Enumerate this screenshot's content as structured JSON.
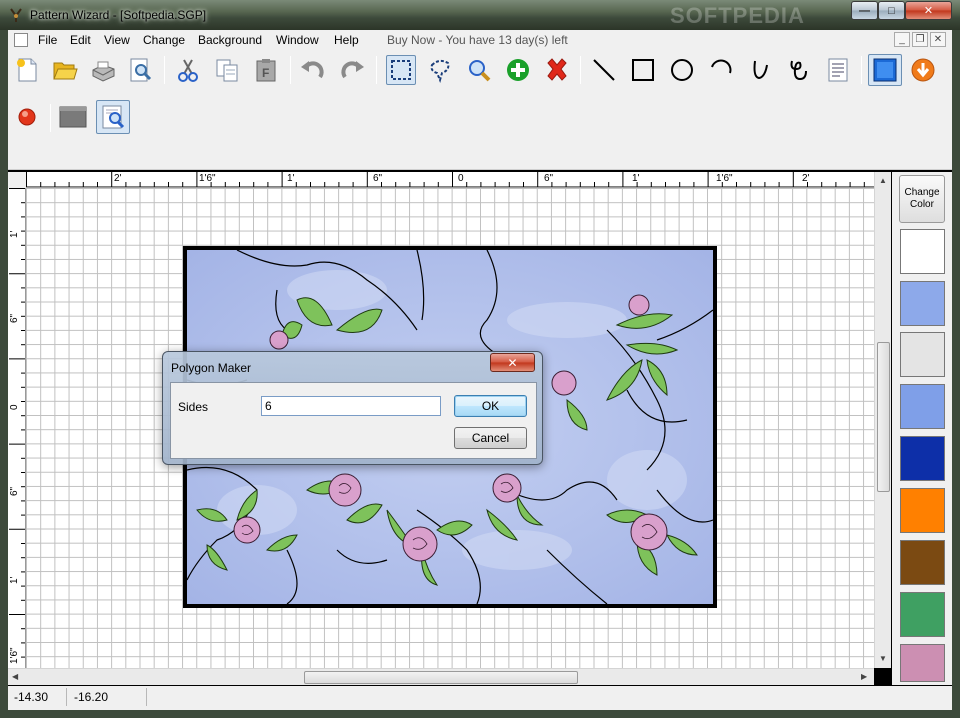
{
  "window": {
    "title": "Pattern Wizard - [Softpedia.SGP]",
    "watermark": "SOFTPEDIA",
    "minimize_glyph": "—",
    "maximize_glyph": "□",
    "close_glyph": "✕"
  },
  "menu": {
    "items": [
      "File",
      "Edit",
      "View",
      "Change",
      "Background",
      "Window",
      "Help"
    ],
    "trial_notice": "Buy Now - You have 13 day(s) left",
    "mdi_min": "_",
    "mdi_restore": "❐",
    "mdi_close": "✕"
  },
  "toolbar": {
    "row1": [
      "new-icon",
      "open-icon",
      "scanner-icon",
      "print-preview-icon",
      "cut-icon",
      "copy-icon",
      "paste-icon",
      "undo-icon",
      "redo-icon",
      "rect-select-icon",
      "lasso-select-icon",
      "zoom-icon",
      "add-icon",
      "delete-icon",
      "line-icon",
      "rectangle-icon",
      "circle-icon",
      "arc-icon",
      "curve-icon",
      "freehand-icon",
      "text-icon",
      "glass-icon",
      "download-icon"
    ],
    "row2": [
      "record-icon",
      "background-icon",
      "zoom-window-icon"
    ]
  },
  "rulers": {
    "horizontal": [
      "2'",
      "1'6\"",
      "1'",
      "6\"",
      "0",
      "6\"",
      "1'",
      "1'6\"",
      "2'"
    ],
    "vertical": [
      "1'",
      "6\"",
      "0",
      "6\"",
      "1'",
      "1'6\""
    ]
  },
  "palette": {
    "button_label_line1": "Change",
    "button_label_line2": "Color",
    "swatches": [
      "#ffffff",
      "#8da9ea",
      "#e4e4e4",
      "#7f9fe8",
      "#0d2fa8",
      "#ff8000",
      "#7b4a12",
      "#3fa062",
      "#cc8fb2"
    ]
  },
  "dialog": {
    "title": "Polygon Maker",
    "close_glyph": "✕",
    "sides_label": "Sides",
    "sides_value": "6",
    "ok_label": "OK",
    "cancel_label": "Cancel"
  },
  "status": {
    "x": "-14.30",
    "y": "-16.20"
  },
  "colors": {
    "design_background": "#aebce9",
    "leaf": "#7ec25b",
    "rose": "#d9a0cc",
    "dialog_default_button": "#3c7fb1"
  }
}
